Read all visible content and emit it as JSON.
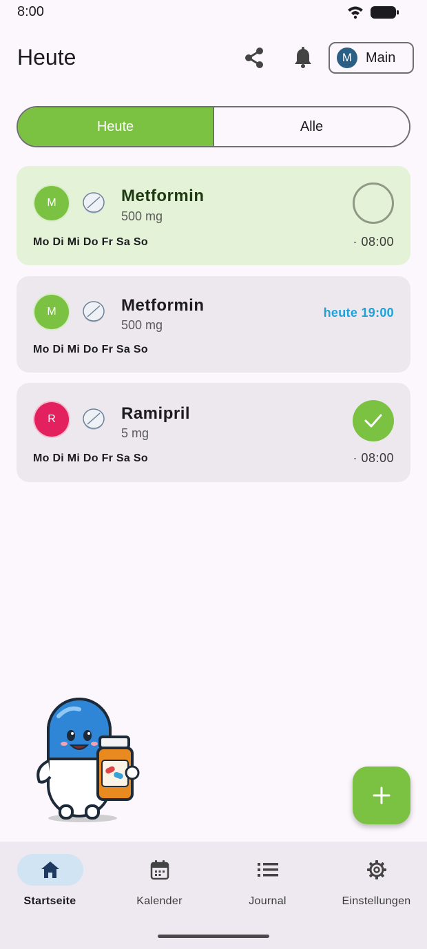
{
  "status_bar": {
    "time": "8:00"
  },
  "app_bar": {
    "title": "Heute",
    "profile": {
      "initial": "M",
      "name": "Main"
    }
  },
  "tabs": {
    "today": "Heute",
    "all": "Alle"
  },
  "cards": [
    {
      "initial": "M",
      "name": "Metformin",
      "dose": "500 mg",
      "days": "Mo Di Mi Do Fr Sa So",
      "time": "· 08:00",
      "state": "pending"
    },
    {
      "initial": "M",
      "name": "Metformin",
      "dose": "500 mg",
      "days": "Mo Di Mi Do Fr Sa So",
      "upcoming": "heute 19:00",
      "state": "upcoming"
    },
    {
      "initial": "R",
      "name": "Ramipril",
      "dose": "5 mg",
      "days": "Mo Di Mi Do Fr Sa So",
      "time": "· 08:00",
      "state": "taken"
    }
  ],
  "bottom_nav": [
    {
      "label": "Startseite",
      "icon": "home-icon",
      "active": true
    },
    {
      "label": "Kalender",
      "icon": "calendar-icon",
      "active": false
    },
    {
      "label": "Journal",
      "icon": "list-icon",
      "active": false
    },
    {
      "label": "Einstellungen",
      "icon": "gear-icon",
      "active": false
    }
  ],
  "colors": {
    "accent_green": "#7bc142",
    "card_active_bg": "#e4f2d7",
    "card_bg": "#ece8ee",
    "upcoming_blue": "#21a0d8",
    "avatar_red": "#e2215e"
  }
}
